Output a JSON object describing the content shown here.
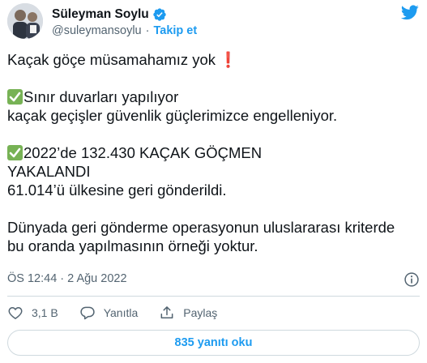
{
  "author": {
    "display_name": "Süleyman Soylu",
    "handle": "@suleymansoylu",
    "separator": "·",
    "follow_label": "Takip et"
  },
  "tweet": {
    "line1": "Kaçak göçe müsamahamız yok",
    "line2": "Sınır duvarları yapılıyor\nkaçak geçişler güvenlik güçlerimizce engelleniyor.",
    "line3": "2022’de 132.430 KAÇAK GÖÇMEN\nYAKALANDI\n61.014’ü ülkesine geri gönderildi.",
    "line4": "Dünyada geri gönderme operasyonun uluslararası kriterde\nbu oranda yapılmasının örneği yoktur.",
    "exclamation": "❗"
  },
  "meta": {
    "timestamp": "ÖS 12:44 · 2 Ağu 2022"
  },
  "actions": {
    "like_count": "3,1 B",
    "reply_label": "Yanıtla",
    "share_label": "Paylaş"
  },
  "replies_button_label": "835 yanıtı oku",
  "colors": {
    "accent": "#1d9bf0",
    "text": "#0f1419",
    "secondary": "#536471",
    "border": "#cfd9de",
    "check_green": "#77b255",
    "exclamation_red": "#dd2e44"
  },
  "icons": [
    "avatar",
    "verified-badge-icon",
    "twitter-bird-icon",
    "check-mark-emoji",
    "exclamation-emoji",
    "info-icon",
    "heart-icon",
    "reply-icon",
    "share-icon"
  ]
}
